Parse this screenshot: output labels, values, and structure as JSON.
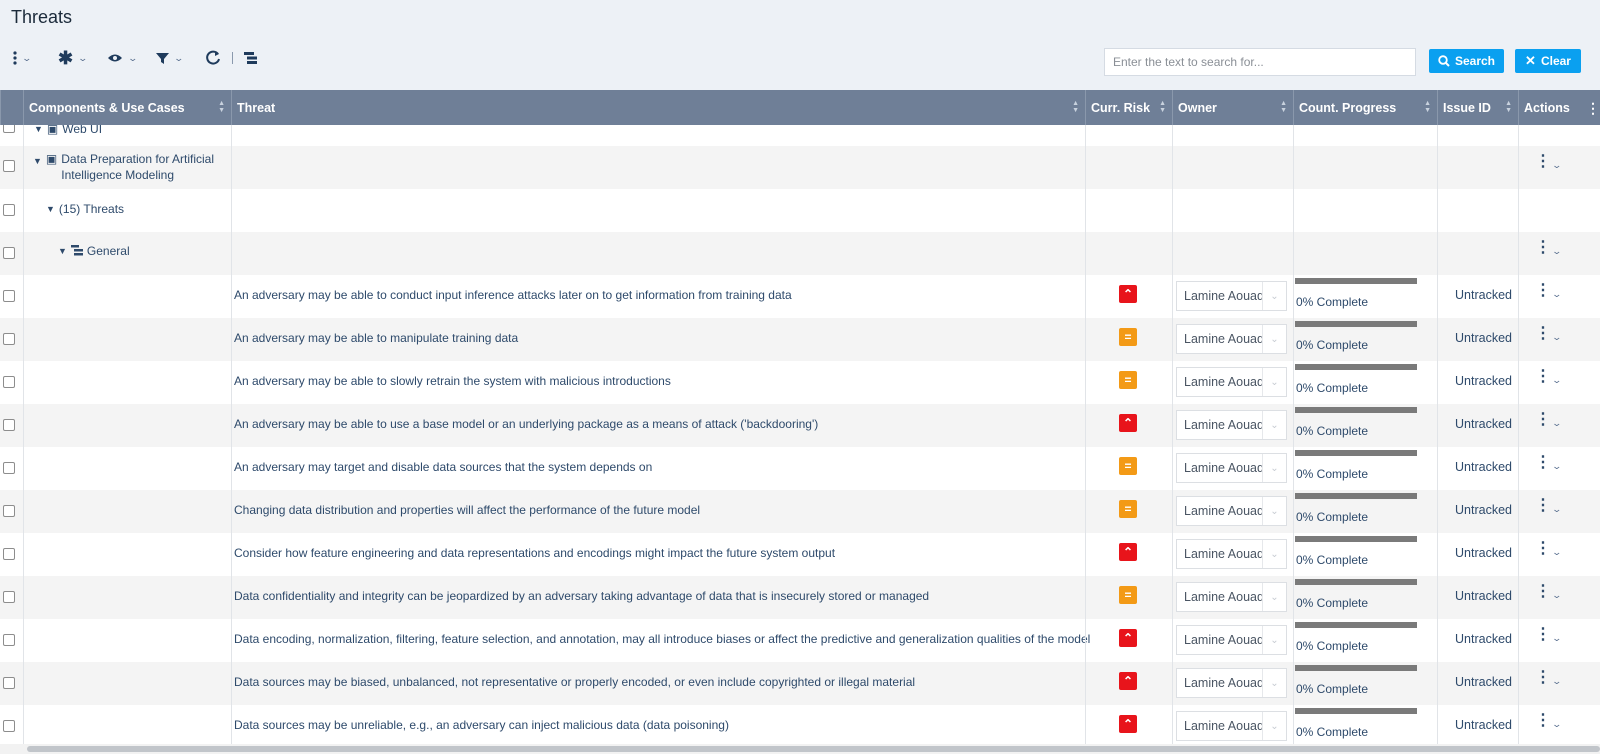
{
  "page": {
    "title": "Threats"
  },
  "toolbar": {
    "search_placeholder": "Enter the text to search for...",
    "search_label": "Search",
    "clear_label": "Clear"
  },
  "columns": {
    "components": "Components & Use Cases",
    "threat": "Threat",
    "risk": "Curr. Risk",
    "owner": "Owner",
    "progress": "Count. Progress",
    "issue": "Issue ID",
    "actions": "Actions"
  },
  "tree": {
    "partial_label": "Web UI",
    "component_label": "Data Preparation for Artificial Intelligence Modeling",
    "threats_group": "(15) Threats",
    "general_label": "General"
  },
  "threats": [
    {
      "text": "An adversary may be able to conduct input inference attacks later on to get information from training data",
      "risk": "high",
      "owner": "Lamine Aouad",
      "progress_pct": 0,
      "progress": "0% Complete",
      "issue": "Untracked"
    },
    {
      "text": "An adversary may be able to manipulate training data",
      "risk": "medium",
      "owner": "Lamine Aouad",
      "progress_pct": 0,
      "progress": "0% Complete",
      "issue": "Untracked"
    },
    {
      "text": "An adversary may be able to slowly retrain the system with malicious introductions",
      "risk": "medium",
      "owner": "Lamine Aouad",
      "progress_pct": 0,
      "progress": "0% Complete",
      "issue": "Untracked"
    },
    {
      "text": "An adversary may be able to use a base model or an underlying package as a means of attack ('backdooring')",
      "risk": "high",
      "owner": "Lamine Aouad",
      "progress_pct": 0,
      "progress": "0% Complete",
      "issue": "Untracked"
    },
    {
      "text": "An adversary may target and disable data sources that the system depends on",
      "risk": "medium",
      "owner": "Lamine Aouad",
      "progress_pct": 0,
      "progress": "0% Complete",
      "issue": "Untracked"
    },
    {
      "text": "Changing data distribution and properties will affect the performance of the future model",
      "risk": "medium",
      "owner": "Lamine Aouad",
      "progress_pct": 0,
      "progress": "0% Complete",
      "issue": "Untracked"
    },
    {
      "text": "Consider how feature engineering and data representations and encodings might impact the future system output",
      "risk": "high",
      "owner": "Lamine Aouad",
      "progress_pct": 0,
      "progress": "0% Complete",
      "issue": "Untracked"
    },
    {
      "text": "Data confidentiality and integrity can be jeopardized by an adversary taking advantage of data that is insecurely stored or managed",
      "risk": "medium",
      "owner": "Lamine Aouad",
      "progress_pct": 0,
      "progress": "0% Complete",
      "issue": "Untracked"
    },
    {
      "text": "Data encoding, normalization, filtering, feature selection, and annotation, may all introduce biases or affect the predictive and generalization qualities of the model",
      "risk": "high",
      "owner": "Lamine Aouad",
      "progress_pct": 0,
      "progress": "0% Complete",
      "issue": "Untracked"
    },
    {
      "text": "Data sources may be biased, unbalanced, not representative or properly encoded, or even include copyrighted or illegal material",
      "risk": "high",
      "owner": "Lamine Aouad",
      "progress_pct": 0,
      "progress": "0% Complete",
      "issue": "Untracked"
    },
    {
      "text": "Data sources may be unreliable, e.g., an adversary can inject malicious data (data poisoning)",
      "risk": "high",
      "owner": "Lamine Aouad",
      "progress_pct": 0,
      "progress": "0% Complete",
      "issue": "Untracked"
    }
  ],
  "colors": {
    "header_bg": "#6f7f97",
    "accent": "#0aa0f0",
    "risk_high": "#e8141b",
    "risk_medium": "#f39a16"
  }
}
